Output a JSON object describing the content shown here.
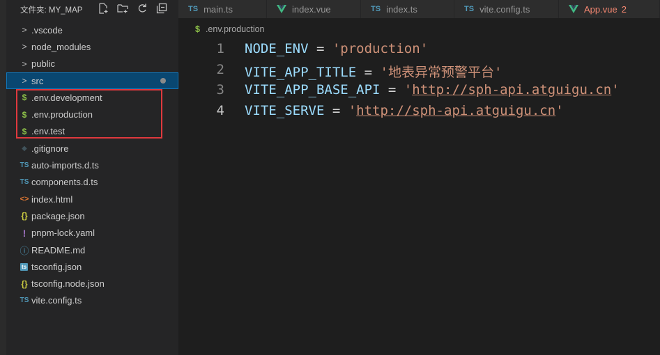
{
  "explorer": {
    "title": "文件夹: MY_MAP",
    "items": [
      {
        "label": ".vscode",
        "icon": ">",
        "kind": "folder"
      },
      {
        "label": "node_modules",
        "icon": ">",
        "kind": "folder"
      },
      {
        "label": "public",
        "icon": ">",
        "kind": "folder"
      },
      {
        "label": "src",
        "icon": ">",
        "kind": "folder"
      },
      {
        "label": ".env.development",
        "icon": "$",
        "kind": "env"
      },
      {
        "label": ".env.production",
        "icon": "$",
        "kind": "env"
      },
      {
        "label": ".env.test",
        "icon": "$",
        "kind": "env"
      },
      {
        "label": ".gitignore",
        "icon": "◆",
        "kind": "git"
      },
      {
        "label": "auto-imports.d.ts",
        "icon": "TS",
        "kind": "ts"
      },
      {
        "label": "components.d.ts",
        "icon": "TS",
        "kind": "ts"
      },
      {
        "label": "index.html",
        "icon": "<>",
        "kind": "html"
      },
      {
        "label": "package.json",
        "icon": "{}",
        "kind": "json"
      },
      {
        "label": "pnpm-lock.yaml",
        "icon": "!",
        "kind": "yaml"
      },
      {
        "label": "README.md",
        "icon": "ⓘ",
        "kind": "md"
      },
      {
        "label": "tsconfig.json",
        "icon": "ts",
        "kind": "tsconfig"
      },
      {
        "label": "tsconfig.node.json",
        "icon": "{}",
        "kind": "json"
      },
      {
        "label": "vite.config.ts",
        "icon": "TS",
        "kind": "ts"
      }
    ]
  },
  "tabs": [
    {
      "label": "main.ts",
      "icon": "TS",
      "modified": ""
    },
    {
      "label": "index.vue",
      "icon": "V",
      "modified": ""
    },
    {
      "label": "index.ts",
      "icon": "TS",
      "modified": ""
    },
    {
      "label": "vite.config.ts",
      "icon": "TS",
      "modified": ""
    },
    {
      "label": "App.vue",
      "icon": "V",
      "modified": "2"
    }
  ],
  "editor": {
    "breadcrumb_icon": "$",
    "breadcrumb": ".env.production",
    "lines": [
      {
        "num": "1",
        "key": "NODE_ENV",
        "eq": " = ",
        "q1": "'",
        "value": "production",
        "q2": "'"
      },
      {
        "num": "2",
        "key": "VITE_APP_TITLE",
        "eq": " = ",
        "q1": "'",
        "value": "地表异常预警平台",
        "q2": "'"
      },
      {
        "num": "3",
        "key": "VITE_APP_BASE_API",
        "eq": " = ",
        "q1": "'",
        "value": "http://sph-api.atguigu.cn",
        "q2": "'"
      },
      {
        "num": "4",
        "key": "VITE_SERVE",
        "eq": " = ",
        "q1": "'",
        "value": "http://sph-api.atguigu.cn",
        "q2": "'"
      }
    ]
  },
  "colors": {
    "accent_selection": "#094771",
    "env_icon": "#8dc149",
    "ts_icon": "#519aba",
    "vue_icon": "#41b883",
    "highlight_box": "#e0393e",
    "string": "#ce9178",
    "key": "#9cdcfe"
  }
}
